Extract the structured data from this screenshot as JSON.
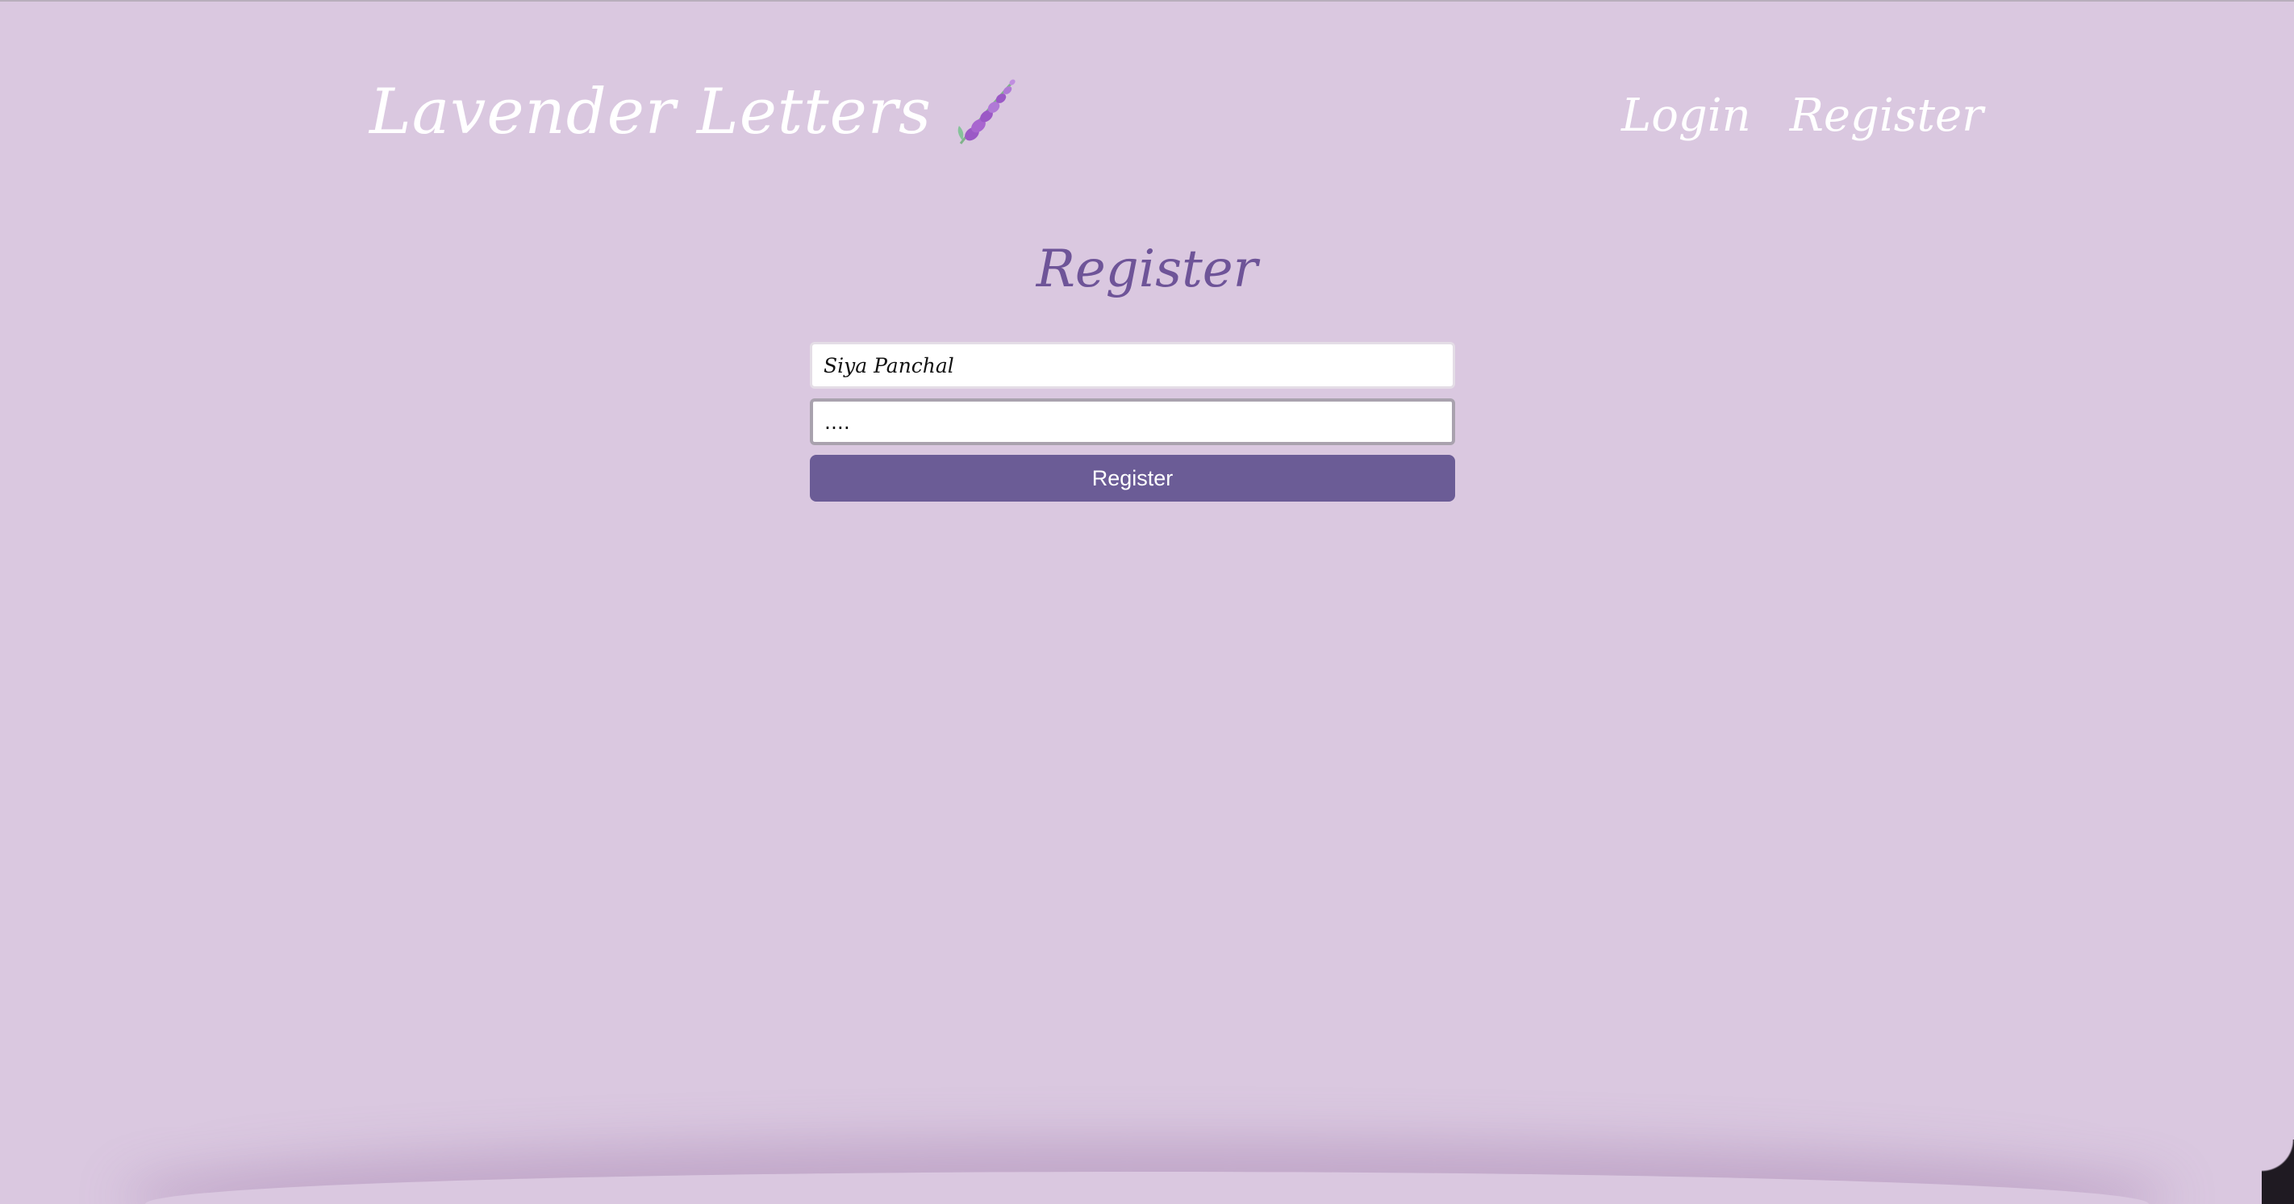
{
  "header": {
    "brand_title": "Lavender Letters",
    "brand_icon": "lavender-sprig-icon",
    "nav": {
      "login_label": "Login",
      "register_label": "Register"
    }
  },
  "form": {
    "title": "Register",
    "username_value": "Siya Panchal",
    "password_value": "....",
    "submit_label": "Register"
  },
  "colors": {
    "background": "#dac8e0",
    "accent": "#6b5c96",
    "title": "#6e5498"
  }
}
